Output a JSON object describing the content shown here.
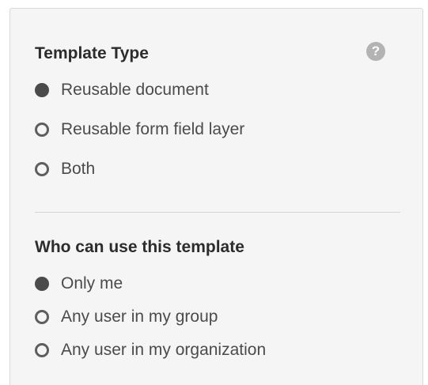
{
  "template_type": {
    "title": "Template Type",
    "help_icon": "?",
    "options": [
      {
        "label": "Reusable document",
        "checked": true
      },
      {
        "label": "Reusable form field layer",
        "checked": false
      },
      {
        "label": "Both",
        "checked": false
      }
    ]
  },
  "who_can_use": {
    "title": "Who can use this template",
    "options": [
      {
        "label": "Only me",
        "checked": true
      },
      {
        "label": "Any user in my group",
        "checked": false
      },
      {
        "label": "Any user in my organization",
        "checked": false
      }
    ]
  },
  "colors": {
    "panel_background": "#f5f5f5",
    "radio_fill": "#4b4b4b",
    "help_icon": "#b3b3b3"
  }
}
